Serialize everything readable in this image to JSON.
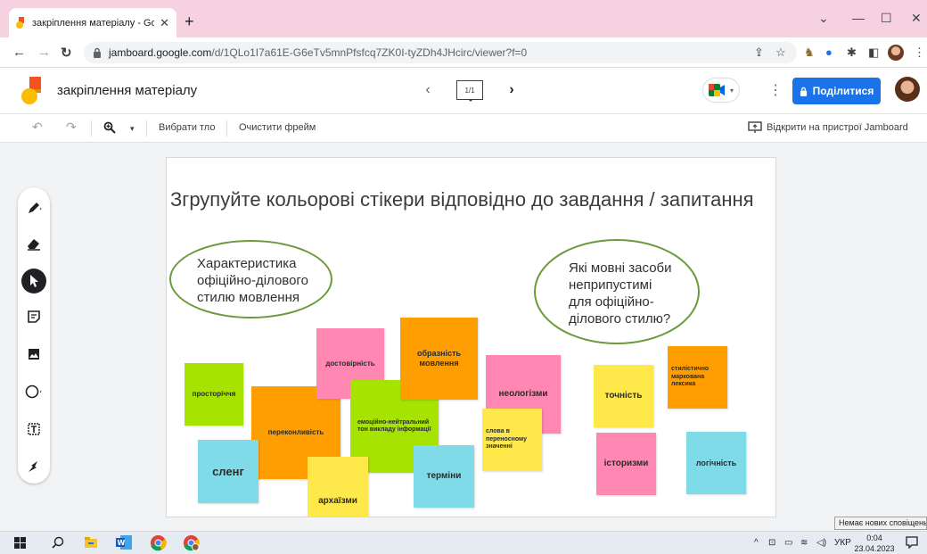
{
  "browser": {
    "tab_title": "закріплення матеріалу - Google",
    "tab_close": "✕",
    "new_tab": "+",
    "url_host": "jamboard.google.com",
    "url_path": "/d/1QLo1I7a61E-G6eTv5mnPfsfcq7ZK0I-tyZDh4JHcirc/viewer?f=0",
    "minimize": "—",
    "maximize": "☐",
    "close": "✕",
    "chevron": "⌄"
  },
  "app": {
    "title": "закріплення матеріалу",
    "frame_indicator": "1/1",
    "share_label": "Поділитися"
  },
  "toolbar": {
    "set_background": "Вибрати тло",
    "clear_frame": "Очистити фрейм",
    "open_on_device": "Відкрити на пристрої Jamboard"
  },
  "canvas": {
    "heading": "Згрупуйте кольорові стікери відповідно до завдання / запитання",
    "ellipse_left": "Характеристика\nофіційно-ділового\nстилю мовлення",
    "ellipse_right": "Які мовні засоби\nнеприпустимі\nдля офіційно-\nділового стилю?",
    "stickies": {
      "prostorichchia": "просторіччя",
      "perekonlyvist": "переконливість",
      "dostovirnist": "достовірність",
      "emotsiino": "емоційно-нейтральний тон викладу інформації",
      "obraznist": "образність мовлення",
      "neolohizmy": "неологізми",
      "slova": "слова в переносному значенні",
      "slenh": "сленг",
      "arkhaizmy": "архаїзми",
      "terminy": "терміни",
      "tochnist": "точність",
      "stylistychno": "стилістично маркована лексика",
      "istoryzmy": "історизми",
      "lohichnist": "логічність"
    },
    "colors": {
      "green": "#a6e300",
      "orange": "#ff9e00",
      "pink": "#ff87b2",
      "cyan": "#80dbe8",
      "yellow": "#ffe84a",
      "ellipse_border": "#6a9a3c"
    }
  },
  "taskbar": {
    "notification": "Немає нових сповіщень",
    "lang": "УКР",
    "time": "0:04",
    "date": "23.04.2023"
  }
}
